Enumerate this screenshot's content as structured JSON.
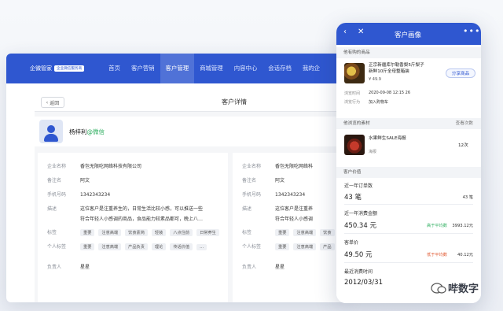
{
  "desktop": {
    "brand": "企微管家",
    "brand_badge": "企业微信服务商",
    "nav": [
      "首页",
      "客户营销",
      "客户管理",
      "商城管理",
      "内容中心",
      "会话存档",
      "我的企"
    ],
    "back_label": "返回",
    "page_title": "客户详情",
    "customer_name": "杨梓利",
    "customer_source": "@微信",
    "left_fields": [
      {
        "label": "企业名称",
        "value": "香包无限吃网络科技有限公司"
      },
      {
        "label": "备注名",
        "value": "阿文"
      },
      {
        "label": "手机号码",
        "value": "1342343234"
      },
      {
        "label": "描述",
        "value": "这位客户是注重养生的，日常生活比较小感，可以推送一些"
      },
      {
        "label": "",
        "value": "符合年轻人小感调的商品，食品能力较素品都可，晚上八…"
      }
    ],
    "left_tags_label": "标签",
    "left_tags": [
      "重要",
      "注意高端",
      "饮食素简",
      "轻装",
      "八点住前",
      "日常养生"
    ],
    "left_persona_label": "个人标签",
    "left_persona": [
      "重要",
      "注意高端",
      "产品负责",
      "理论",
      "传话价值",
      "…"
    ],
    "left_owner_label": "负责人",
    "left_owner": "星星",
    "right_fields": [
      {
        "label": "企业名称",
        "value": "香包无限吃网络科"
      },
      {
        "label": "备注名",
        "value": "阿文"
      },
      {
        "label": "手机号码",
        "value": "1342343234"
      },
      {
        "label": "描述",
        "value": "这位客户是注重养"
      },
      {
        "label": "",
        "value": "符合年轻人小感调"
      }
    ],
    "right_tags_label": "标签",
    "right_tags": [
      "重要",
      "注意高端",
      "饮食"
    ],
    "right_persona_label": "个人标签",
    "right_persona": [
      "重要",
      "注意高端",
      "产品"
    ],
    "right_owner_label": "负责人",
    "right_owner": "星星"
  },
  "phone": {
    "title": "客户画像",
    "purchased_title": "他有购的商品",
    "product_name_1": "正宗新疆库尔勒香梨5斤梨子",
    "product_name_2": "新鲜10斤全母整箱装",
    "product_price": "¥ 49.9",
    "share_label": "分享商品",
    "purchase_time_label": "浏览时间",
    "purchase_time": "2020-09-08 12:15 26",
    "purchase_status_label": "浏览行为",
    "purchase_status": "加入购物车",
    "viewed_title": "他浏览的素材",
    "viewed_right": "查看次数",
    "material_name": "水果鲜生SALE海报",
    "material_type": "海报",
    "material_count": "12次",
    "value_title": "客户价值",
    "metrics": [
      {
        "label": "近一年订单数",
        "value": "43 笔",
        "side": "",
        "side2": "43 笔"
      },
      {
        "label": "近一年消费金额",
        "value": "450.34 元",
        "side": "高于平均数",
        "side2": "3993.12元"
      },
      {
        "label": "客单价",
        "value": "49.50 元",
        "side": "低于平均数",
        "side2": "40.12元"
      },
      {
        "label": "最近消费时间",
        "value": "2012/03/31",
        "side": "",
        "side2": ""
      }
    ]
  },
  "watermark": "哔数字",
  "colors": {
    "primary": "#2f57d0",
    "up": "#2dae5f",
    "down": "#e0542b"
  },
  "icons": [
    "back-arrow-icon",
    "close-icon",
    "more-dots-icon",
    "avatar-icon",
    "watermark-logo-icon"
  ]
}
